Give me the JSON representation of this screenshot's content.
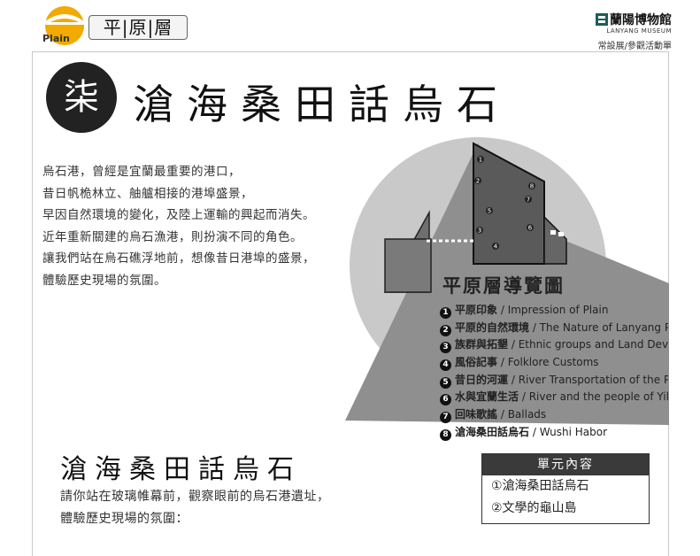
{
  "header": {
    "logo_en": "Plain",
    "tab_label": "平|原|層",
    "museum_name": "蘭陽博物館",
    "museum_en": "LANYANG MUSEUM",
    "museum_sub": "常設展/參觀活動單"
  },
  "unit": {
    "number": "柒",
    "title": "滄海桑田話烏石"
  },
  "intro": {
    "lines": [
      "烏石港，曾經是宜蘭最重要的港口，",
      "昔日帆桅林立、舳艫相接的港埠盛景，",
      "早因自然環境的變化，及陸上運輸的興起而消失。",
      "近年重新關建的烏石漁港，則扮演不同的角色。",
      "讓我們站在烏石礁浮地前，想像昔日港埠的盛景，",
      "體驗歷史現場的氛圍。"
    ]
  },
  "map": {
    "title": "平原層導覽圖",
    "numbers": [
      "1",
      "2",
      "3",
      "4",
      "5",
      "6",
      "7",
      "8"
    ],
    "legend": [
      {
        "num": "1",
        "zh": "平原印象",
        "en": " / Impression of Plain"
      },
      {
        "num": "2",
        "zh": "平原的自然環境",
        "en": " / The Nature of Lanyang P"
      },
      {
        "num": "3",
        "zh": "族群與拓墾",
        "en": " / Ethnic groups and Land Deve"
      },
      {
        "num": "4",
        "zh": "風俗記事",
        "en": " / Folklore Customs"
      },
      {
        "num": "5",
        "zh": "昔日的河運",
        "en": " / River Transportation of the Pa"
      },
      {
        "num": "6",
        "zh": "水與宜蘭生活",
        "en": " / River and the people of Yila"
      },
      {
        "num": "7",
        "zh": "回味歌謠",
        "en": " / Ballads"
      },
      {
        "num": "8",
        "zh": "滄海桑田話烏石",
        "en": " / Wushi Habor"
      }
    ]
  },
  "section": {
    "title": "滄海桑田話烏石",
    "lines": [
      "請你站在玻璃帷幕前，觀察眼前的烏石港遺址，",
      "體驗歷史現場的氛圍："
    ]
  },
  "content_box": {
    "heading": "單元內容",
    "items": [
      "①滄海桑田話烏石",
      "②文學的龜山島"
    ]
  },
  "colors": {
    "dark": "#222222",
    "map_gray": "#9a9a9a",
    "circle_gray": "#c6c6c6"
  }
}
